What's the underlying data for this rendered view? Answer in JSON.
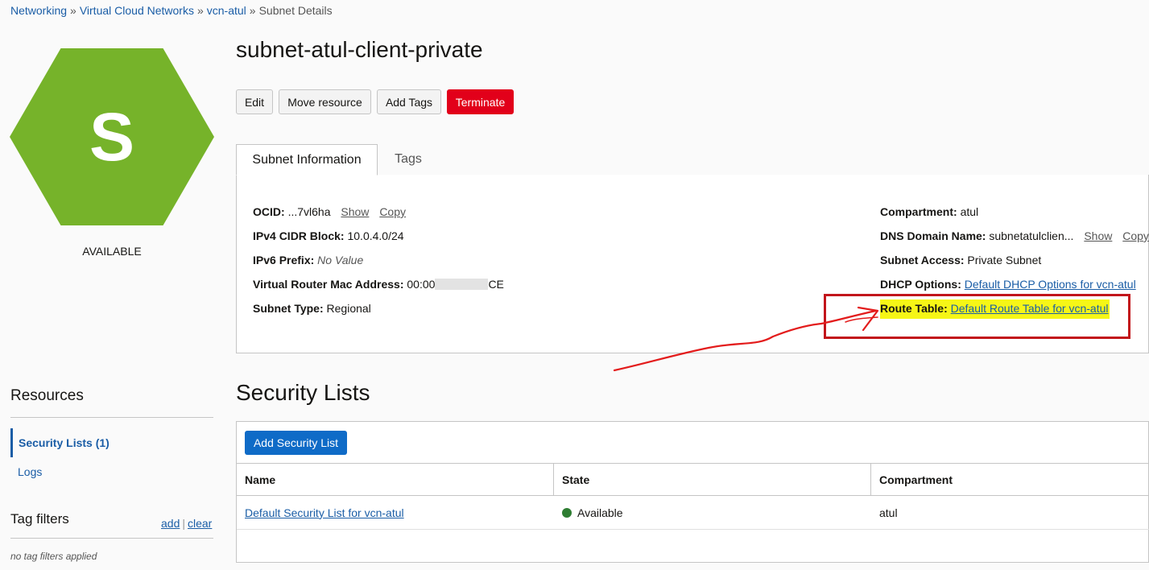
{
  "breadcrumb": {
    "items": [
      "Networking",
      "Virtual Cloud Networks",
      "vcn-atul"
    ],
    "current": "Subnet Details",
    "separator": "»"
  },
  "resource_icon": {
    "letter": "S",
    "color": "#76b32a",
    "status": "AVAILABLE"
  },
  "page_title": "subnet-atul-client-private",
  "actions": {
    "edit": "Edit",
    "move": "Move resource",
    "add_tags": "Add Tags",
    "terminate": "Terminate"
  },
  "tabs": {
    "subnet_info": "Subnet Information",
    "tags": "Tags"
  },
  "subnet_info": {
    "ocid_label": "OCID:",
    "ocid_value": "...7vl6ha",
    "show": "Show",
    "copy": "Copy",
    "ipv4_label": "IPv4 CIDR Block:",
    "ipv4_value": "10.0.4.0/24",
    "ipv6_label": "IPv6 Prefix:",
    "ipv6_value": "No Value",
    "vr_mac_label": "Virtual Router Mac Address:",
    "vr_mac_prefix": "00:00",
    "vr_mac_suffix": "CE",
    "subnet_type_label": "Subnet Type:",
    "subnet_type_value": "Regional",
    "compartment_label": "Compartment:",
    "compartment_value": "atul",
    "dns_label": "DNS Domain Name:",
    "dns_value": "subnetatulclien...",
    "access_label": "Subnet Access:",
    "access_value": "Private Subnet",
    "dhcp_label": "DHCP Options:",
    "dhcp_value": "Default DHCP Options for vcn-atul",
    "route_label": "Route Table:",
    "route_value": "Default Route Table for vcn-atul"
  },
  "security_lists": {
    "title": "Security Lists",
    "add_button": "Add Security List",
    "columns": [
      "Name",
      "State",
      "Compartment"
    ],
    "rows": [
      {
        "name": "Default Security List for vcn-atul",
        "state": "Available",
        "compartment": "atul"
      }
    ]
  },
  "sidebar": {
    "resources_title": "Resources",
    "items": [
      "Security Lists (1)",
      "Logs"
    ],
    "tag_filters_title": "Tag filters",
    "add": "add",
    "clear": "clear",
    "no_filters": "no tag filters applied"
  },
  "colors": {
    "accent": "#1a5da6",
    "primary_button": "#0f6bc7",
    "danger": "#e2001a",
    "highlight": "#f6f616",
    "annotation": "#c2151b"
  }
}
